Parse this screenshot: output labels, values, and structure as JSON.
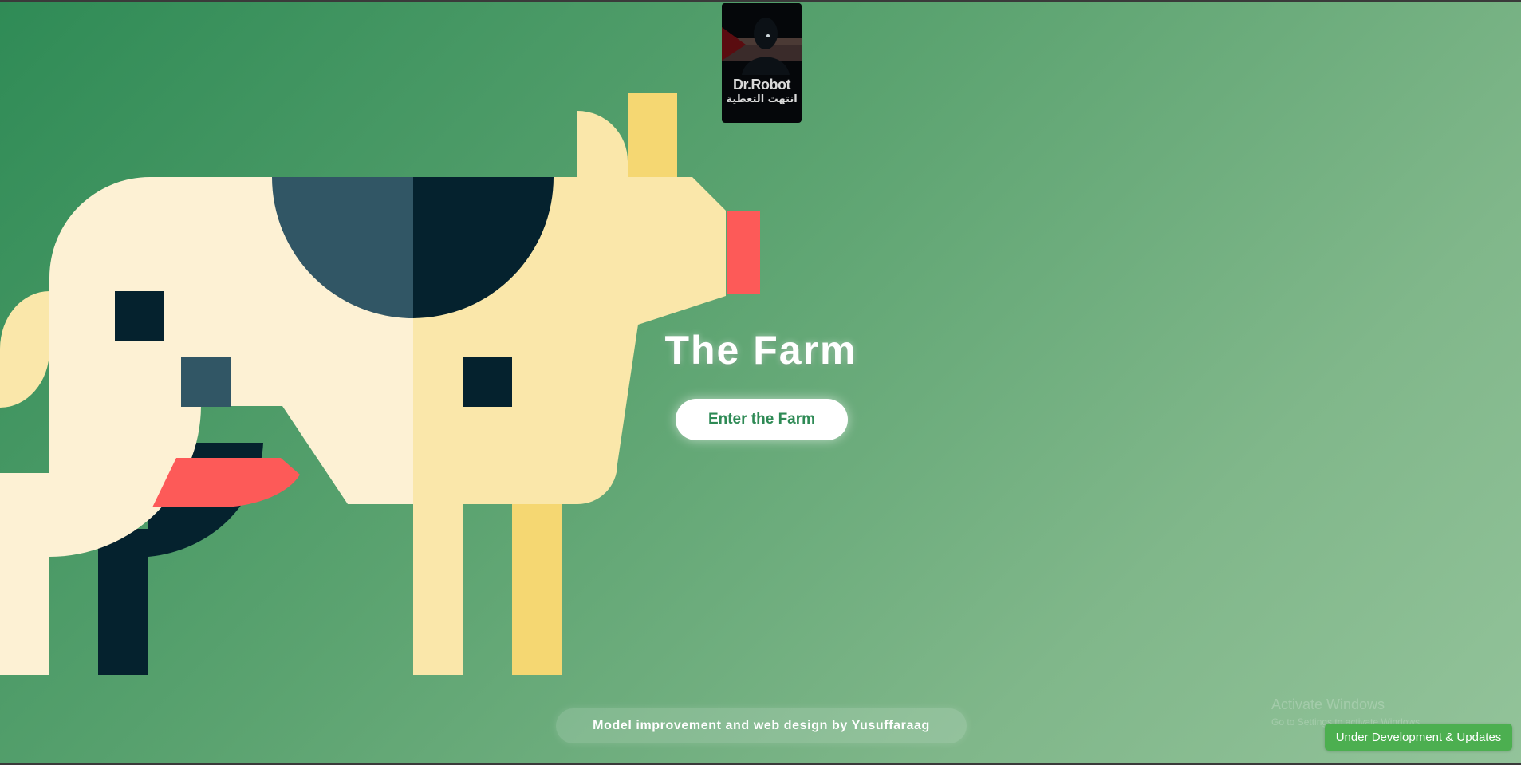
{
  "badge": {
    "line1": "Dr.Robot",
    "line2": "انتهت التغطية"
  },
  "hero": {
    "title": "The Farm",
    "enter_label": "Enter the Farm"
  },
  "footer": {
    "credit": "Model improvement and web design by Yusuffaraag"
  },
  "watermark": {
    "line1": "Activate Windows",
    "line2": "Go to Settings to activate Windows."
  },
  "status": {
    "dev_label": "Under Development & Updates"
  },
  "colors": {
    "background_start": "#2f8b56",
    "background_end": "#93c39a",
    "cow_cream": "#fdf1d4",
    "cow_yellow": "#fae7aa",
    "cow_gold": "#f5d772",
    "cow_navy": "#05222e",
    "cow_slate": "#315665",
    "cow_red": "#fd5a58",
    "button_text": "#2e8a55",
    "status_badge": "#4caf50"
  }
}
